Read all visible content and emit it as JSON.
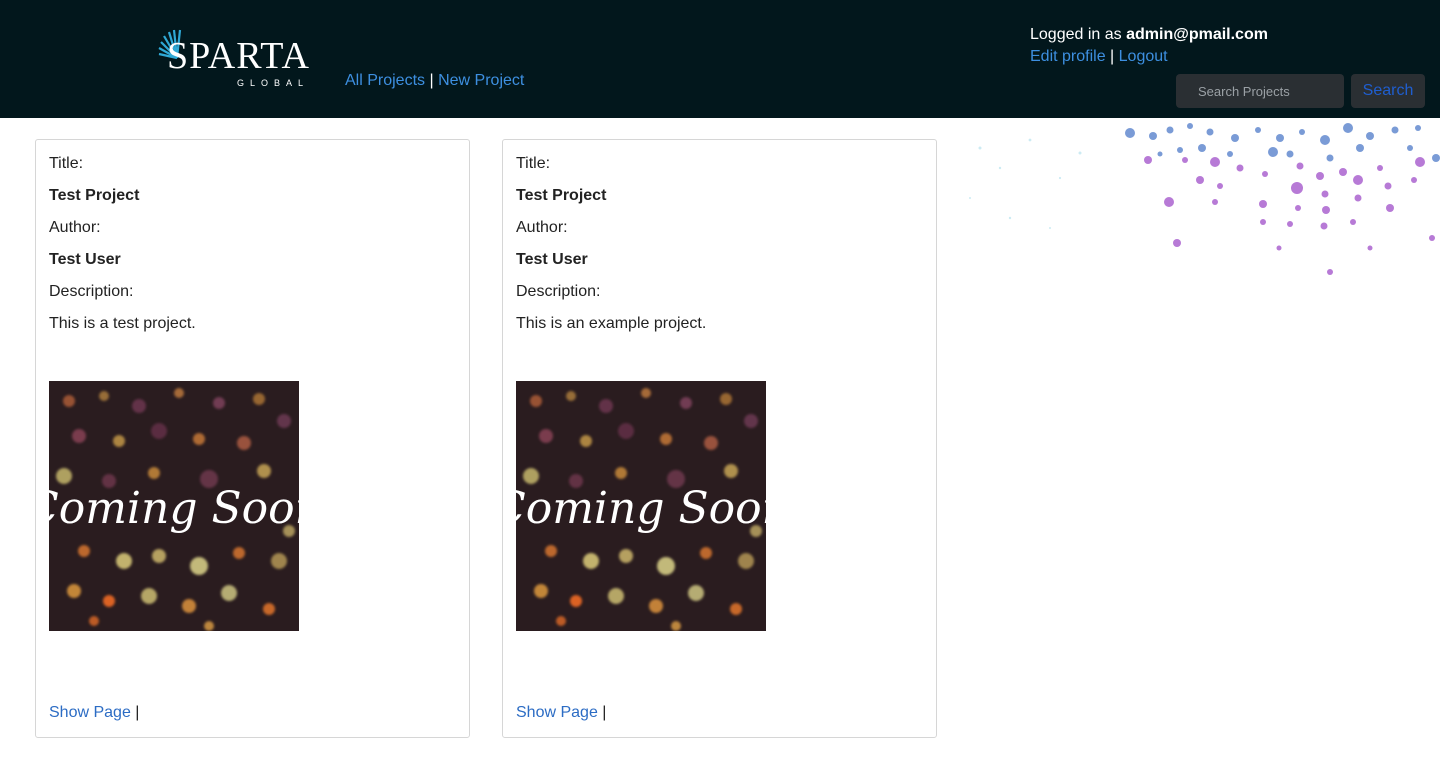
{
  "brand": {
    "name": "SPARTA",
    "sub": "GLOBAL"
  },
  "nav": {
    "all_projects": "All Projects",
    "separator": "|",
    "new_project": "New Project"
  },
  "user": {
    "logged_in_prefix": "Logged in as",
    "email": "admin@pmail.com",
    "edit_profile": "Edit profile",
    "separator": "|",
    "logout": "Logout"
  },
  "search": {
    "placeholder": "Search Projects",
    "button": "Search"
  },
  "projects": [
    {
      "title_label": "Title:",
      "title": "Test Project",
      "author_label": "Author:",
      "author": "Test User",
      "description_label": "Description:",
      "description": "This is a test project.",
      "image_text": "Coming Soon",
      "show_link": "Show Page",
      "footer_separator": "|"
    },
    {
      "title_label": "Title:",
      "title": "Test Project",
      "author_label": "Author:",
      "author": "Test User",
      "description_label": "Description:",
      "description": "This is an example project.",
      "image_text": "Coming Soon",
      "show_link": "Show Page",
      "footer_separator": "|"
    }
  ],
  "colors": {
    "header_bg": "#02171c",
    "link": "#3d8fe0",
    "search_bg": "#2a2f33"
  }
}
